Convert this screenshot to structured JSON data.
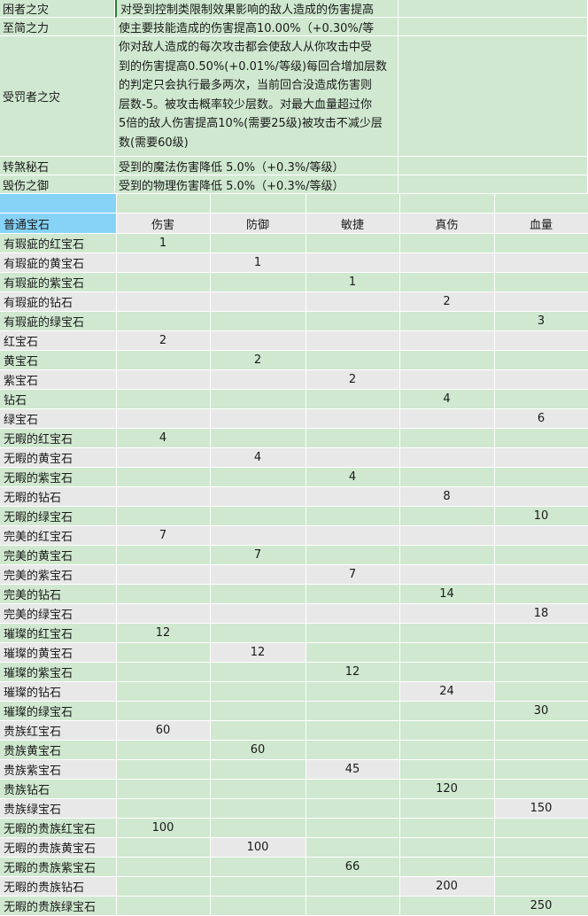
{
  "descriptions": [
    {
      "name": "困者之灾",
      "text": "对受到控制类限制效果影响的敌人造成的伤害提高"
    },
    {
      "name": "至简之力",
      "text": "使主要技能造成的伤害提高10.00%（+0.30%/等"
    },
    {
      "name": "受罚者之灾",
      "lines": [
        "你对敌人造成的每次攻击都会使敌人从你攻击中受",
        "到的伤害提高0.50%(+0.01%/等级)每回合增加层数",
        "的判定只会执行最多两次，当前回合没造成伤害则",
        "层数-5。被攻击概率较少层数。对最大血量超过你",
        "5倍的敌人伤害提高10%(需要25级)被攻击不减少层",
        "数(需要60级)"
      ]
    },
    {
      "name": "转煞秘石",
      "text": "受到的魔法伤害降低 5.0%（+0.3%/等级）"
    },
    {
      "name": "毁伤之御",
      "text": "受到的物理伤害降低 5.0%（+0.3%/等级）"
    }
  ],
  "table": {
    "header": [
      "普通宝石",
      "伤害",
      "防御",
      "敏捷",
      "真伤",
      "血量"
    ],
    "rows": [
      {
        "name": "有瑕疵的红宝石",
        "values": [
          "1",
          "",
          "",
          "",
          ""
        ]
      },
      {
        "name": "有瑕疵的黄宝石",
        "values": [
          "",
          "1",
          "",
          "",
          ""
        ]
      },
      {
        "name": "有瑕疵的紫宝石",
        "values": [
          "",
          "",
          "1",
          "",
          ""
        ]
      },
      {
        "name": "有瑕疵的钻石",
        "values": [
          "",
          "",
          "",
          "2",
          ""
        ]
      },
      {
        "name": "有瑕疵的绿宝石",
        "values": [
          "",
          "",
          "",
          "",
          "3"
        ]
      },
      {
        "name": "红宝石",
        "values": [
          "2",
          "",
          "",
          "",
          ""
        ]
      },
      {
        "name": "黄宝石",
        "values": [
          "",
          "2",
          "",
          "",
          ""
        ]
      },
      {
        "name": "紫宝石",
        "values": [
          "",
          "",
          "2",
          "",
          ""
        ]
      },
      {
        "name": "钻石",
        "values": [
          "",
          "",
          "",
          "4",
          ""
        ]
      },
      {
        "name": "绿宝石",
        "values": [
          "",
          "",
          "",
          "",
          "6"
        ]
      },
      {
        "name": "无暇的红宝石",
        "values": [
          "4",
          "",
          "",
          "",
          ""
        ]
      },
      {
        "name": "无暇的黄宝石",
        "values": [
          "",
          "4",
          "",
          "",
          ""
        ]
      },
      {
        "name": "无暇的紫宝石",
        "values": [
          "",
          "",
          "4",
          "",
          ""
        ]
      },
      {
        "name": "无暇的钻石",
        "values": [
          "",
          "",
          "",
          "8",
          ""
        ]
      },
      {
        "name": "无暇的绿宝石",
        "values": [
          "",
          "",
          "",
          "",
          "10"
        ]
      },
      {
        "name": "完美的红宝石",
        "values": [
          "7",
          "",
          "",
          "",
          ""
        ]
      },
      {
        "name": "完美的黄宝石",
        "values": [
          "",
          "7",
          "",
          "",
          ""
        ]
      },
      {
        "name": "完美的紫宝石",
        "values": [
          "",
          "",
          "7",
          "",
          ""
        ]
      },
      {
        "name": "完美的钻石",
        "values": [
          "",
          "",
          "",
          "14",
          ""
        ]
      },
      {
        "name": "完美的绿宝石",
        "values": [
          "",
          "",
          "",
          "",
          "18"
        ]
      },
      {
        "name": "璀璨的红宝石",
        "values": [
          "12",
          "",
          "",
          "",
          ""
        ]
      },
      {
        "name": "璀璨的黄宝石",
        "values": [
          "",
          "12",
          "",
          "",
          ""
        ]
      },
      {
        "name": "璀璨的紫宝石",
        "values": [
          "",
          "",
          "12",
          "",
          ""
        ]
      },
      {
        "name": "璀璨的钻石",
        "values": [
          "",
          "",
          "",
          "24",
          ""
        ]
      },
      {
        "name": "璀璨的绿宝石",
        "values": [
          "",
          "",
          "",
          "",
          "30"
        ]
      },
      {
        "name": "贵族红宝石",
        "values": [
          "60",
          "",
          "",
          "",
          ""
        ]
      },
      {
        "name": "贵族黄宝石",
        "values": [
          "",
          "60",
          "",
          "",
          ""
        ]
      },
      {
        "name": "贵族紫宝石",
        "values": [
          "",
          "",
          "45",
          "",
          ""
        ]
      },
      {
        "name": "贵族钻石",
        "values": [
          "",
          "",
          "",
          "120",
          ""
        ]
      },
      {
        "name": "贵族绿宝石",
        "values": [
          "",
          "",
          "",
          "",
          "150"
        ]
      },
      {
        "name": "无暇的贵族红宝石",
        "values": [
          "100",
          "",
          "",
          "",
          ""
        ]
      },
      {
        "name": "无暇的贵族黄宝石",
        "values": [
          "",
          "100",
          "",
          "",
          ""
        ]
      },
      {
        "name": "无暇的贵族紫宝石",
        "values": [
          "",
          "",
          "66",
          "",
          ""
        ]
      },
      {
        "name": "无暇的贵族钻石",
        "values": [
          "",
          "",
          "",
          "200",
          ""
        ]
      },
      {
        "name": "无暇的贵族绿宝石",
        "values": [
          "",
          "",
          "",
          "",
          "250"
        ]
      }
    ]
  },
  "colors": {
    "green_fill": "#cfe8cf",
    "gray_fill": "#e8e8e8",
    "selected_header": "#87d3f8"
  }
}
